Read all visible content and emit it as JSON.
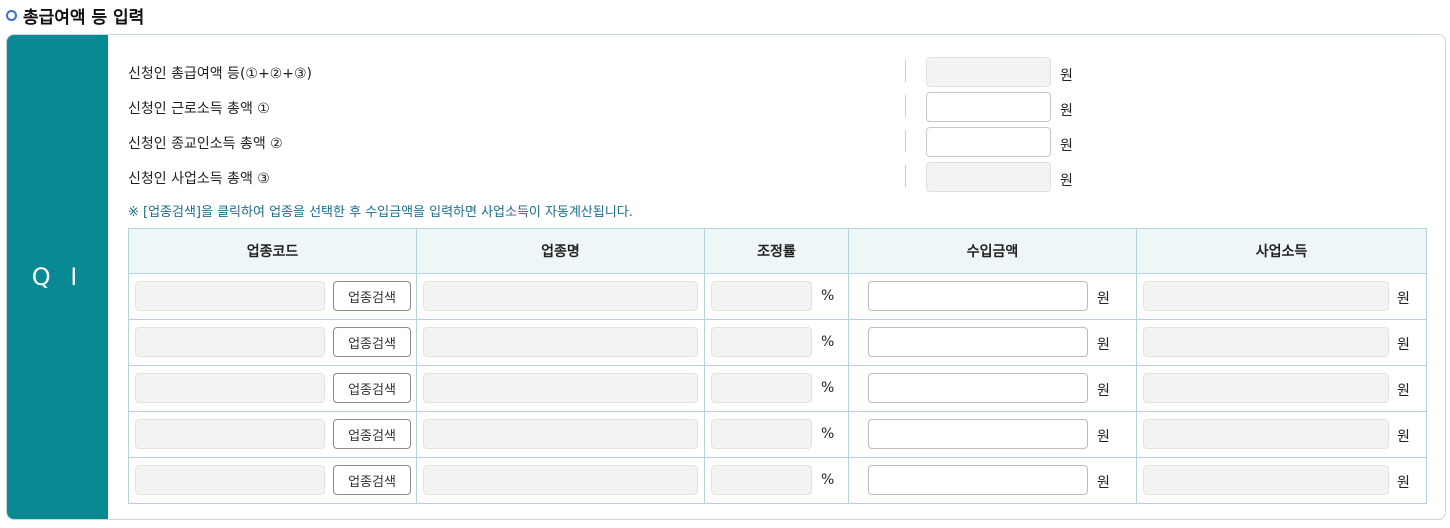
{
  "section": {
    "title": "총급여액 등 입력"
  },
  "side": {
    "label": "Q I"
  },
  "income_rows": [
    {
      "label": "신청인 총급여액 등(①+②+③)",
      "value": "",
      "unit": "원",
      "readonly": true
    },
    {
      "label": "신청인 근로소득 총액 ①",
      "value": "",
      "unit": "원",
      "readonly": false
    },
    {
      "label": "신청인 종교인소득 총액 ②",
      "value": "",
      "unit": "원",
      "readonly": false
    },
    {
      "label": "신청인 사업소득 총액 ③",
      "value": "",
      "unit": "원",
      "readonly": true
    }
  ],
  "notice": "※ [업종검색]을 클릭하여 업종을 선택한 후 수입금액을 입력하면 사업소득이 자동계산됩니다.",
  "table": {
    "headers": [
      "업종코드",
      "업종명",
      "조정률",
      "수입금액",
      "사업소득"
    ],
    "search_button_label": "업종검색",
    "percent_unit": "%",
    "won_unit": "원",
    "rows": [
      {
        "code": "",
        "name": "",
        "rate": "",
        "income": "",
        "business_income": ""
      },
      {
        "code": "",
        "name": "",
        "rate": "",
        "income": "",
        "business_income": ""
      },
      {
        "code": "",
        "name": "",
        "rate": "",
        "income": "",
        "business_income": ""
      },
      {
        "code": "",
        "name": "",
        "rate": "",
        "income": "",
        "business_income": ""
      },
      {
        "code": "",
        "name": "",
        "rate": "",
        "income": "",
        "business_income": ""
      }
    ]
  },
  "colors": {
    "side_bg": "#078a94",
    "header_bg": "#eef7f7",
    "accent_blue": "#3f6fcf",
    "notice_text": "#1a6e8a"
  }
}
